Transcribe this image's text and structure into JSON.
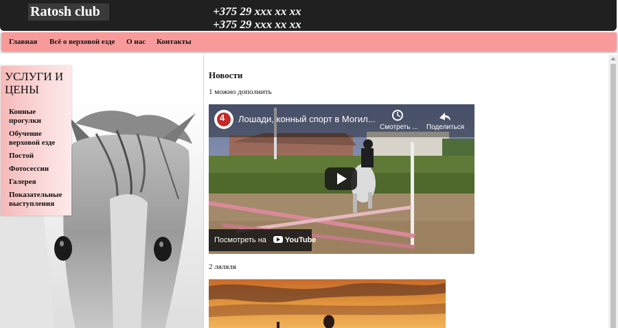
{
  "header": {
    "logo": "Ratosh club",
    "phones": [
      "+375 29 xxx xx xx",
      "+375 29 xxx xx xx"
    ]
  },
  "nav": {
    "items": [
      {
        "label": "Главная"
      },
      {
        "label": "Всё о верховой езде"
      },
      {
        "label": "О нас"
      },
      {
        "label": "Контакты"
      }
    ]
  },
  "sidebar": {
    "title": "УСЛУГИ И ЦЕНЫ",
    "items": [
      {
        "label": "Конные прогулки"
      },
      {
        "label": "Обучение верховой езде"
      },
      {
        "label": "Постой"
      },
      {
        "label": "Фотосессии"
      },
      {
        "label": "Галерея"
      },
      {
        "label": "Показательные выступления"
      }
    ]
  },
  "main": {
    "news_title": "Новости",
    "posts": [
      {
        "caption": "1 можно дополнить"
      },
      {
        "caption": "2 ляляля"
      }
    ],
    "video": {
      "channel_badge": "4",
      "title": "Лошади, конный спорт в Могил...",
      "watch_later": "Смотреть ...",
      "share": "Поделиться",
      "watch_on": "Посмотреть на",
      "youtube": "YouTube"
    }
  },
  "colors": {
    "header_bg": "#202020",
    "nav_bg": "#f99a9a",
    "sidebar_gradient_start": "#f5b9b9"
  }
}
